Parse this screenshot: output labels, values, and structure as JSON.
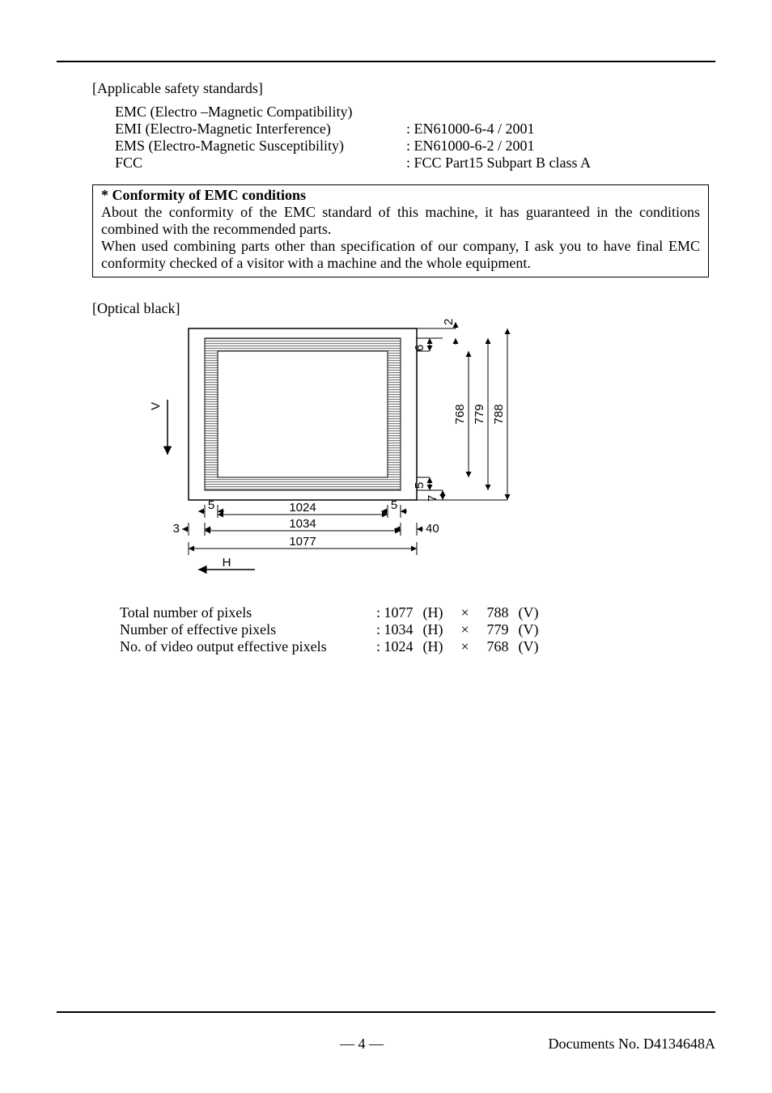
{
  "safety": {
    "heading": "[Applicable safety standards]",
    "emc_line": "EMC (Electro –Magnetic Compatibility)",
    "emi_l": "EMI (Electro-Magnetic Interference)",
    "emi_r": ": EN61000-6-4 / 2001",
    "ems_l": "EMS (Electro-Magnetic Susceptibility)",
    "ems_r": ": EN61000-6-2 / 2001",
    "fcc_l": "FCC",
    "fcc_r": ": FCC Part15 Subpart B class A"
  },
  "box": {
    "title": "* Conformity of EMC conditions",
    "p1": "About the conformity of the EMC standard of this machine, it has guaranteed in the conditions combined with the recommended parts.",
    "p2": "When used combining parts other than specification of our company, I ask you to have final EMC conformity checked of a visitor with a machine and the whole equipment."
  },
  "optical": {
    "heading": "[Optical black]",
    "labels": {
      "H": "H",
      "V": "V",
      "n3": "3",
      "n5a": "5",
      "n5b": "5",
      "n40": "40",
      "n1024": "1024",
      "n1034": "1034",
      "n1077": "1077",
      "n2": "2",
      "n6": "6",
      "n5v": "5",
      "n7": "7",
      "n768": "768",
      "n779": "779",
      "n788": "788"
    }
  },
  "pixel_rows": [
    {
      "label": "Total number of pixels",
      "a": ": 1077",
      "h": "(H)",
      "x": "×",
      "b": "788",
      "v": "(V)"
    },
    {
      "label": "Number of effective pixels",
      "a": ": 1034",
      "h": "(H)",
      "x": "×",
      "b": "779",
      "v": "(V)"
    },
    {
      "label": "No. of video output effective pixels",
      "a": ": 1024",
      "h": "(H)",
      "x": "×",
      "b": "768",
      "v": "(V)"
    }
  ],
  "footer": {
    "page": "— 4 —",
    "doc": "Documents No. D4134648A"
  }
}
